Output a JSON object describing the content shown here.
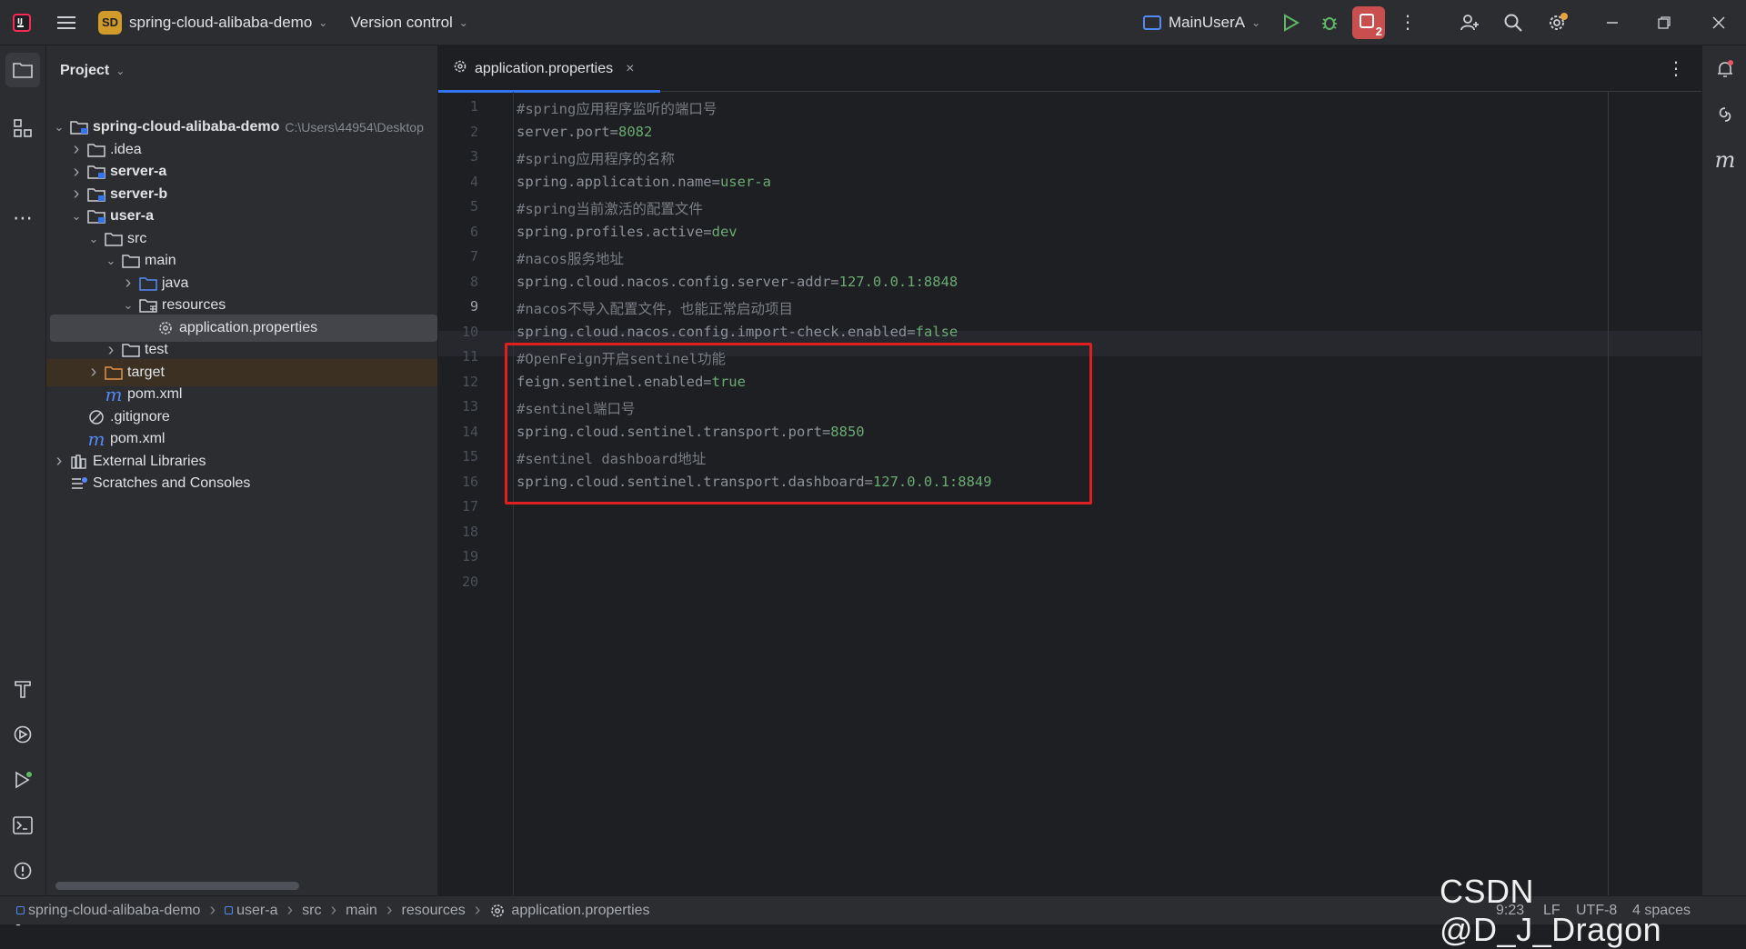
{
  "titlebar": {
    "project_badge": "SD",
    "project_name": "spring-cloud-alibaba-demo",
    "vcs_label": "Version control",
    "run_config": "MainUserA",
    "notifications_count": "2"
  },
  "project_panel": {
    "title": "Project",
    "tree": [
      {
        "label": "spring-cloud-alibaba-demo",
        "path": "C:\\Users\\44954\\Desktop",
        "bold": true,
        "icon": "module-folder-icon",
        "expanded": true
      },
      {
        "label": ".idea",
        "icon": "folder-icon",
        "expanded": false
      },
      {
        "label": "server-a",
        "bold": true,
        "icon": "module-folder-icon",
        "expanded": false
      },
      {
        "label": "server-b",
        "bold": true,
        "icon": "module-folder-icon",
        "expanded": false
      },
      {
        "label": "user-a",
        "bold": true,
        "icon": "module-folder-icon",
        "expanded": true
      },
      {
        "label": "src",
        "icon": "folder-icon",
        "expanded": true
      },
      {
        "label": "main",
        "icon": "folder-icon",
        "expanded": true
      },
      {
        "label": "java",
        "icon": "source-folder-icon",
        "expanded": false
      },
      {
        "label": "resources",
        "icon": "resources-folder-icon",
        "expanded": true
      },
      {
        "label": "application.properties",
        "icon": "gear-file-icon",
        "selected": true
      },
      {
        "label": "test",
        "icon": "folder-icon",
        "expanded": false
      },
      {
        "label": "target",
        "icon": "excluded-folder-icon",
        "expanded": false
      },
      {
        "label": "pom.xml",
        "icon": "maven-icon"
      },
      {
        "label": ".gitignore",
        "icon": "ignore-icon"
      },
      {
        "label": "pom.xml",
        "icon": "maven-icon"
      },
      {
        "label": "External Libraries",
        "icon": "library-icon",
        "expanded": false
      },
      {
        "label": "Scratches and Consoles",
        "icon": "scratches-icon"
      }
    ]
  },
  "editor": {
    "tab_label": "application.properties",
    "lines": [
      {
        "n": "1",
        "comment": "#spring应用程序监听的端口号"
      },
      {
        "n": "2",
        "key": "server.port=",
        "val": "8082"
      },
      {
        "n": "3",
        "comment": "#spring应用程序的名称"
      },
      {
        "n": "4",
        "key": "spring.application.name=",
        "val": "user-a"
      },
      {
        "n": "5",
        "comment": "#spring当前激活的配置文件"
      },
      {
        "n": "6",
        "key": "spring.profiles.active=",
        "val": "dev"
      },
      {
        "n": "7",
        "comment": "#nacos服务地址"
      },
      {
        "n": "8",
        "key": "spring.cloud.nacos.config.server-addr=",
        "val": "127.0.0.1:8848"
      },
      {
        "n": "9",
        "comment": "#nacos不导入配置文件，也能正常启动项目"
      },
      {
        "n": "10",
        "key": "spring.cloud.nacos.config.import-check.enabled=",
        "val": "false"
      },
      {
        "n": "11",
        "comment": "#OpenFeign开启sentinel功能"
      },
      {
        "n": "12",
        "key": "feign.sentinel.enabled=",
        "val": "true"
      },
      {
        "n": "13",
        "comment": "#sentinel端口号"
      },
      {
        "n": "14",
        "key": "spring.cloud.sentinel.transport.port=",
        "val": "8850"
      },
      {
        "n": "15",
        "comment": "#sentinel dashboard地址"
      },
      {
        "n": "16",
        "key": "spring.cloud.sentinel.transport.dashboard=",
        "val": "127.0.0.1:8849"
      },
      {
        "n": "17"
      },
      {
        "n": "18"
      },
      {
        "n": "19"
      },
      {
        "n": "20"
      }
    ]
  },
  "statusbar": {
    "breadcrumbs": [
      "spring-cloud-alibaba-demo",
      "user-a",
      "src",
      "main",
      "resources",
      "application.properties"
    ],
    "position": "9:23",
    "line_sep": "LF",
    "encoding": "UTF-8",
    "indent": "4 spaces"
  },
  "watermark": "CSDN @D_J_Dragon",
  "colors": {
    "accent": "#3574f0",
    "highlight_box": "#e02020",
    "value_green": "#6aab73"
  }
}
